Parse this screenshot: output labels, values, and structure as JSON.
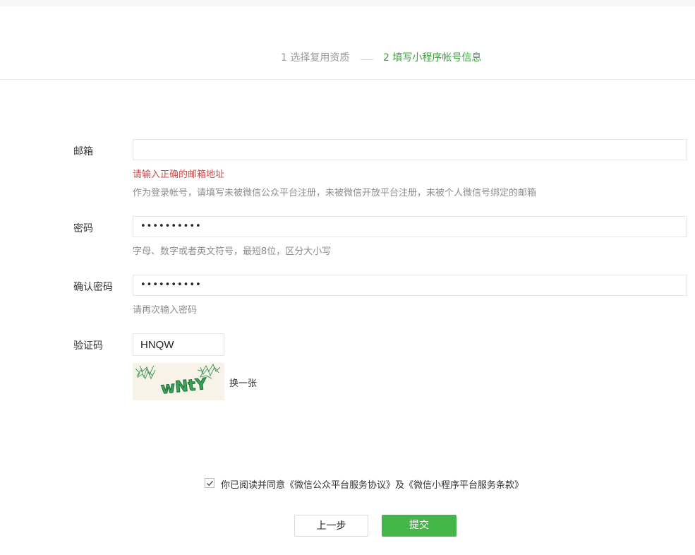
{
  "steps": {
    "step1": "1 选择复用资质",
    "step2": "2 填写小程序帐号信息"
  },
  "form": {
    "email": {
      "label": "邮箱",
      "value": "",
      "error": "请输入正确的邮箱地址",
      "hint": "作为登录帐号，请填写未被微信公众平台注册，未被微信开放平台注册，未被个人微信号绑定的邮箱"
    },
    "password": {
      "label": "密码",
      "masked_value": "••••••••••",
      "hint": "字母、数字或者英文符号，最短8位，区分大小写"
    },
    "confirm_password": {
      "label": "确认密码",
      "masked_value": "••••••••••",
      "hint": "请再次输入密码"
    },
    "captcha": {
      "label": "验证码",
      "value": "HNQW",
      "refresh_label": "换一张",
      "image_text": "wNtY"
    }
  },
  "agreement": {
    "checked": true,
    "text": "你已阅读并同意《微信公众平台服务协议》及《微信小程序平台服务条款》"
  },
  "buttons": {
    "prev": "上一步",
    "submit": "提交"
  },
  "colors": {
    "accent_green": "#44b549",
    "step_active": "#37a43c",
    "error_red": "#c44c4c"
  }
}
